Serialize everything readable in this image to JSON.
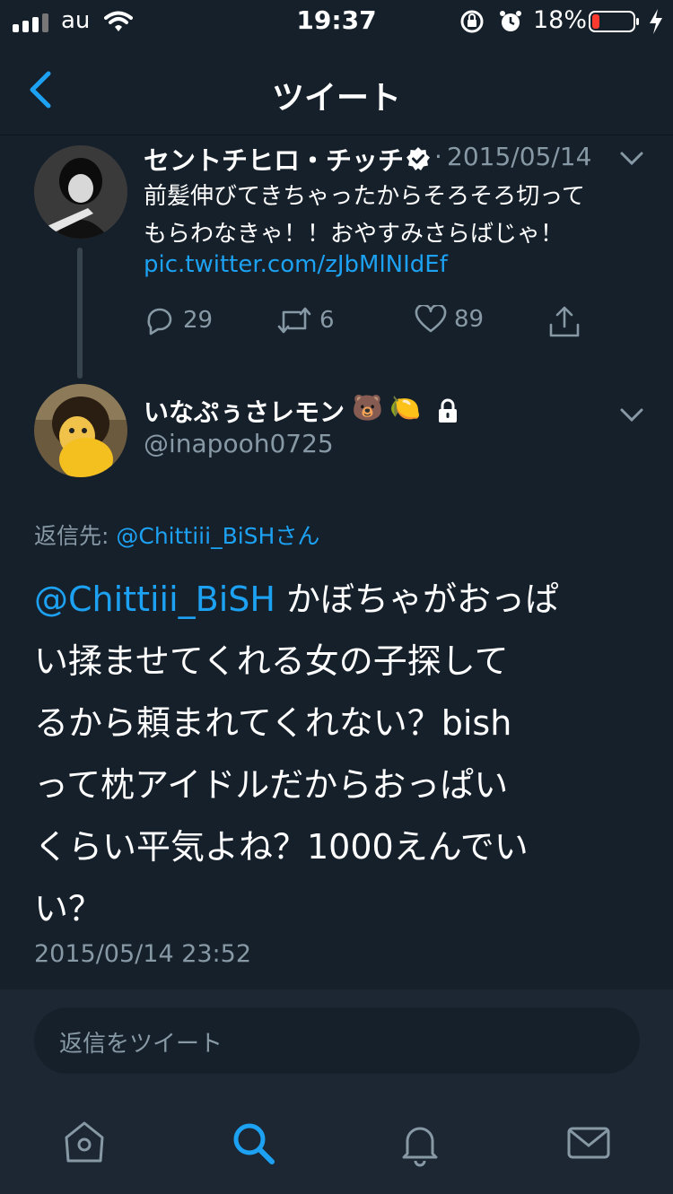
{
  "status": {
    "carrier": "au",
    "time": "19:37",
    "battery": "18%",
    "battery_level": 0.18,
    "signal_icon": "signal-bars-icon",
    "wifi_icon": "wifi-icon",
    "colors": {
      "battery_low": "#ff3b30"
    }
  },
  "nav": {
    "title": "ツイート",
    "back_icon": "chevron-left-icon"
  },
  "parent_tweet": {
    "name": "セントチヒロ・チッチ",
    "date": "2015/05/14",
    "text_line1": "前髪伸びてきちゃったからそろそろ切って",
    "text_line2": "もらわなきゃ！！おやすみさらばじゃ！",
    "link": "pic.twitter.com/zJbMlNIdEf",
    "reply_count": "29",
    "retweet_count": "6",
    "like_count": "89"
  },
  "main_tweet": {
    "name": "いなぷぅさレモン",
    "emoji1": "🐻",
    "emoji2": "🍋",
    "handle": "@inapooh0725",
    "replying_label": "返信先: ",
    "replying_to": "@Chittiii_BiSHさん",
    "mention": "@Chittiii_BiSH",
    "line1_rest": " かぼちゃがおっぱ",
    "line2": "い揉ませてくれる女の子探して",
    "line3": "るから頼まれてくれない？bish",
    "line4": "って枕アイドルだからおっぱい",
    "line5": "くらい平気よね？1000えんでい",
    "line6": "い？",
    "timestamp": "2015/05/14 23:52"
  },
  "reply": {
    "placeholder": "返信をツイート"
  },
  "tabs": [
    "home-icon",
    "search-icon",
    "notifications-icon",
    "messages-icon"
  ],
  "colors": {
    "background": "#15202b",
    "accent": "#1da1f2",
    "muted": "#8899a6"
  }
}
